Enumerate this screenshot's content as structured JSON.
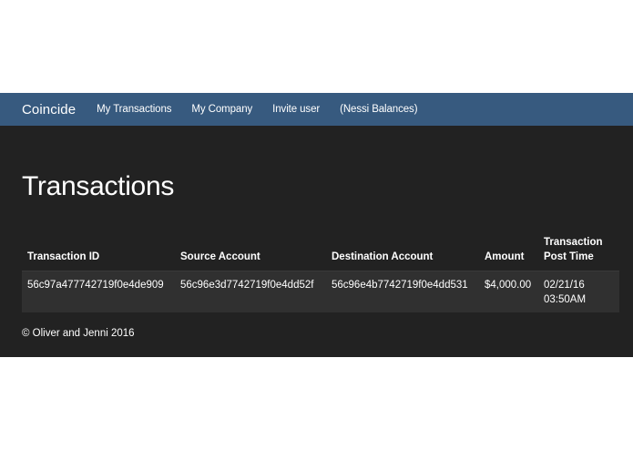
{
  "navbar": {
    "brand": "Coincide",
    "links": [
      "My Transactions",
      "My Company",
      "Invite user",
      "(Nessi Balances)"
    ]
  },
  "page_title": "Transactions",
  "table": {
    "headers": {
      "id": "Transaction ID",
      "source": "Source Account",
      "destination": "Destination Account",
      "amount": "Amount",
      "post_time_line1": "Transaction",
      "post_time_line2": "Post Time"
    },
    "rows": [
      {
        "id": "56c97a477742719f0e4de909",
        "source": "56c96e3d7742719f0e4dd52f",
        "destination": "56c96e4b7742719f0e4dd531",
        "amount": "$4,000.00",
        "post_date": "02/21/16",
        "post_time": "03:50AM"
      }
    ]
  },
  "footer": "© Oliver and Jenni 2016",
  "colors": {
    "navbar": "#375a7f",
    "background": "#222222",
    "row": "#303030"
  }
}
